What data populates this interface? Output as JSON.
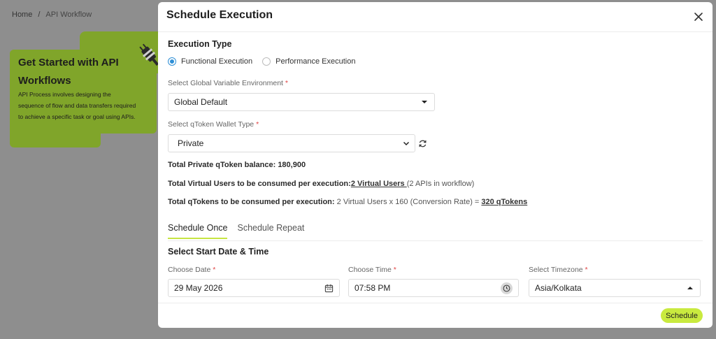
{
  "background": {
    "breadcrumb": {
      "home": "Home",
      "separator": "/",
      "current": "API Workflow"
    },
    "card": {
      "title": "Get Started with API Workflows",
      "text": "API Process involves designing the sequence of flow and data transfers required to achieve a specific task or goal using APIs.",
      "icon": "plug-icon"
    }
  },
  "modal": {
    "title": "Schedule Execution",
    "close_icon": "close-icon",
    "execution_type": {
      "label": "Execution Type",
      "options": [
        {
          "label": "Functional Execution",
          "checked": true
        },
        {
          "label": "Performance Execution",
          "checked": false
        }
      ]
    },
    "global_env": {
      "label": "Select Global Variable Environment",
      "required": "*",
      "value": "Global Default"
    },
    "wallet": {
      "label": "Select qToken Wallet Type",
      "required": "*",
      "value": "Private"
    },
    "balance": {
      "label": "Total Private qToken balance:",
      "value": "180,900"
    },
    "virtual_users": {
      "label": "Total Virtual Users to be consumed per execution:",
      "link": "2 Virtual Users ",
      "note": "(2 APIs in workflow)"
    },
    "qtokens": {
      "label": "Total qTokens to be consumed per execution:",
      "formula": "2 Virtual Users x 160 (Conversion Rate) = ",
      "link": "320 qTokens"
    },
    "tabs": [
      {
        "label": "Schedule Once",
        "active": true
      },
      {
        "label": "Schedule Repeat",
        "active": false
      }
    ],
    "start_section": "Select Start Date & Time",
    "date": {
      "label": "Choose Date",
      "required": "*",
      "value": "29 May 2026",
      "icon": "calendar-icon"
    },
    "time": {
      "label": "Choose Time",
      "required": "*",
      "value": "07:58 PM",
      "icon": "clock-icon"
    },
    "timezone": {
      "label": "Select Timezone",
      "required": "*",
      "value": "Asia/Kolkata"
    },
    "schedule_button": "Schedule"
  },
  "colors": {
    "accent": "#c9ea3f",
    "radio_blue": "#2e8fd6",
    "card_green": "#80a52a",
    "overlay": "#8e8e8e"
  }
}
